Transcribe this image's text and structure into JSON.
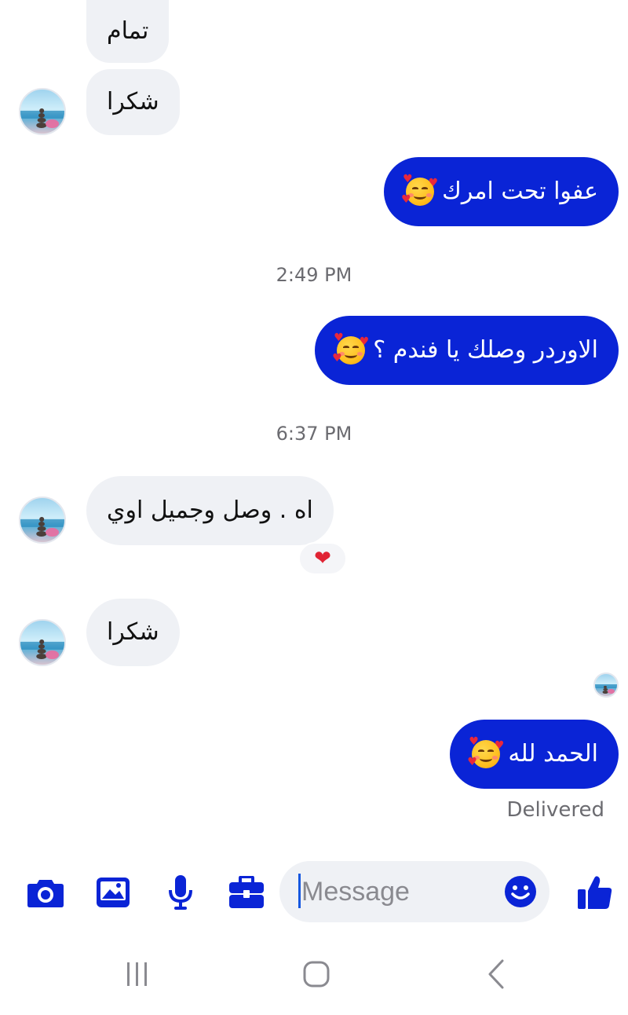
{
  "messages": [
    {
      "side": "in",
      "text": "تمام"
    },
    {
      "side": "in",
      "text": "شكرا"
    },
    {
      "side": "out",
      "text": "عفوا تحت امرك",
      "emoji": "smiling-face-with-hearts"
    },
    {
      "side": "out",
      "text": "الاوردر وصلك يا فندم ؟",
      "emoji": "smiling-face-with-hearts"
    },
    {
      "side": "in",
      "text": "اه . وصل وجميل اوي",
      "reaction": "❤"
    },
    {
      "side": "in",
      "text": "شكرا"
    },
    {
      "side": "out",
      "text": "الحمد لله",
      "emoji": "smiling-face-with-hearts"
    }
  ],
  "timestamps": [
    "2:49 PM",
    "6:37 PM"
  ],
  "status": "Delivered",
  "composer": {
    "placeholder": "Message",
    "icons": [
      "camera-icon",
      "gallery-icon",
      "microphone-icon",
      "briefcase-icon",
      "emoji-icon",
      "thumbs-up-icon"
    ]
  },
  "nav": {
    "icons": [
      "recent-apps-icon",
      "home-icon",
      "back-icon"
    ]
  },
  "colors": {
    "outgoing": "#0a24d6",
    "incoming": "#eff1f5",
    "accent": "#0a24d6"
  }
}
